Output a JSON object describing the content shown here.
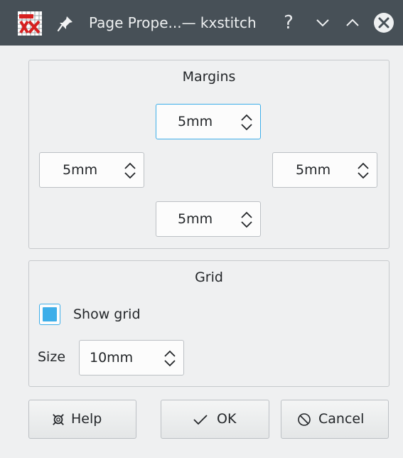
{
  "window": {
    "title": "Page Prope...— kxstitch",
    "help_glyph": "?"
  },
  "margins": {
    "title": "Margins",
    "top": "5mm",
    "left": "5mm",
    "right": "5mm",
    "bottom": "5mm"
  },
  "grid": {
    "title": "Grid",
    "show_grid_label": "Show grid",
    "show_grid_checked": true,
    "size_label": "Size",
    "size_value": "10mm"
  },
  "buttons": {
    "help": "Help",
    "ok": "OK",
    "cancel": "Cancel"
  },
  "colors": {
    "titlebar": "#475057",
    "accent": "#3daee9",
    "window_bg": "#eff0f1"
  }
}
